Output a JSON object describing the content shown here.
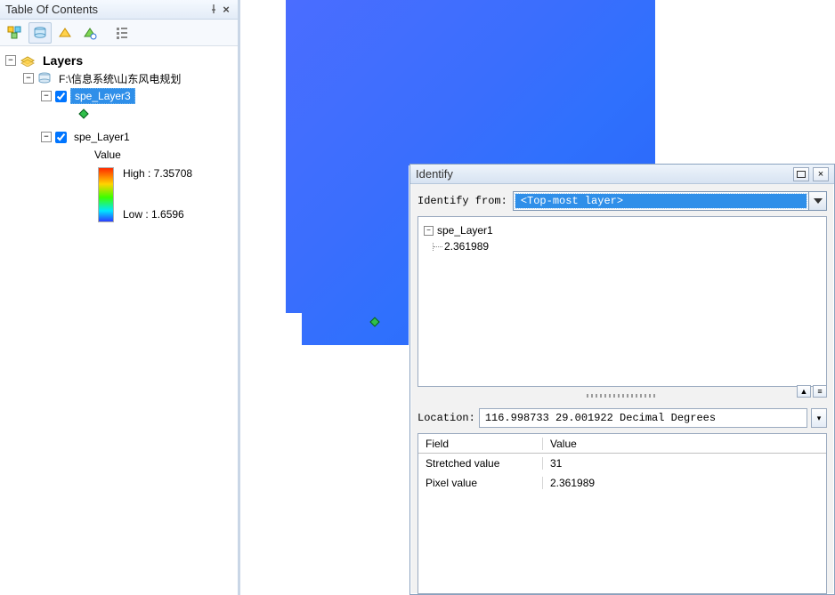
{
  "toc": {
    "title": "Table Of Contents",
    "root_label": "Layers",
    "datasource": "F:\\信息系统\\山东风电规划",
    "items": [
      {
        "label": "spe_Layer3",
        "checked": true,
        "selected": true
      },
      {
        "label": "spe_Layer1",
        "checked": true,
        "selected": false
      }
    ],
    "legend": {
      "title": "Value",
      "high": "High : 7.35708",
      "low": "Low : 1.6596"
    }
  },
  "identify": {
    "title": "Identify",
    "from_label": "Identify from:",
    "from_value": "<Top-most layer>",
    "tree": {
      "layer": "spe_Layer1",
      "value": "2.361989"
    },
    "location_label": "Location:",
    "location_value": "116.998733  29.001922 Decimal Degrees",
    "columns": {
      "field": "Field",
      "value": "Value"
    },
    "rows": [
      {
        "field": "Stretched value",
        "value": "31"
      },
      {
        "field": "Pixel value",
        "value": "2.361989"
      }
    ]
  }
}
